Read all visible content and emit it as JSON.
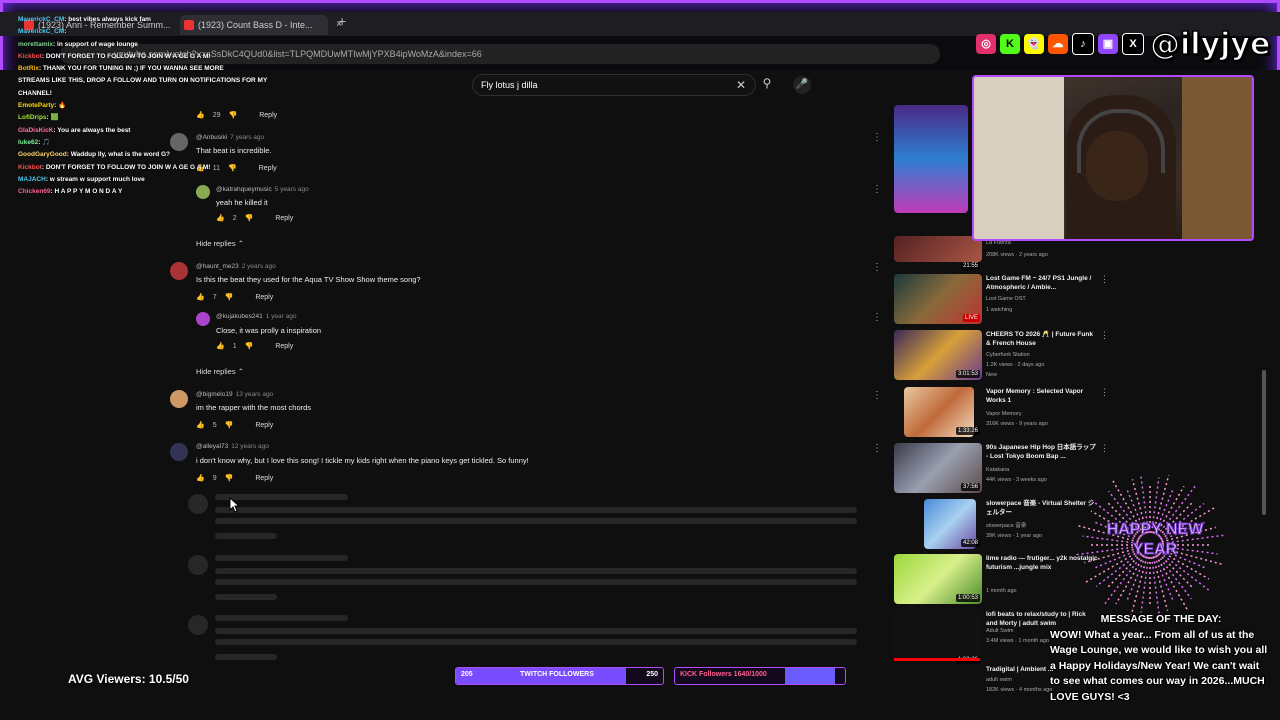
{
  "browser": {
    "tabs": [
      {
        "label": "(1923) Anri - Remember Summ..."
      },
      {
        "label": "(1923) Count Bass D - Inte..."
      }
    ],
    "url": "youtube.com/watch?v=sSsDkC4QUd0&list=TLPQMDUwMTIwMjYPXB4ipWoMzA&index=66"
  },
  "search": {
    "query": "Fly lotus j dilla"
  },
  "comments": [
    {
      "author": "",
      "age": "",
      "text": "",
      "likes": "29",
      "reply": "Reply",
      "partial": true
    },
    {
      "author": "@Anbusiki",
      "age": "7 years ago",
      "text": "That beat is incredible.",
      "likes": "11",
      "reply": "Reply"
    },
    {
      "author": "@katrahqueymusic",
      "age": "5 years ago",
      "text": "yeah he killed it",
      "likes": "2",
      "reply": "Reply",
      "nested": true
    },
    {
      "author": "@haunt_me23",
      "age": "2 years ago",
      "text": "Is this the beat they used for the Aqua TV Show Show theme song?",
      "likes": "7",
      "reply": "Reply"
    },
    {
      "author": "@kujakubes241",
      "age": "1 year ago",
      "text": "Close, it was prolly a inspiration",
      "likes": "1",
      "reply": "Reply",
      "nested": true
    },
    {
      "author": "@bigmelo19",
      "age": "13 years ago",
      "text": "im the rapper with the most chords",
      "likes": "5",
      "reply": "Reply"
    },
    {
      "author": "@alleyal73",
      "age": "12 years ago",
      "text": "i don't know why, but I love this song! I tickle my kids right when the piano keys get tickled.  So funny!",
      "likes": "9",
      "reply": "Reply"
    }
  ],
  "hide_replies": "Hide replies",
  "sidebar": [
    {
      "title": "",
      "meta": [
        "La Fuerza",
        "208K views · 2 years ago"
      ],
      "duration": "21:55"
    },
    {
      "title": "Lost Game FM ~ 24/7 PS1 Jungle / Atmospheric / Ambie...",
      "meta": [
        "Lost Game OST",
        "1 watching"
      ],
      "duration": "LIVE"
    },
    {
      "title": "CHEERS TO 2026 🥂 | Future Funk & French House",
      "meta": [
        "Cyberfunk Station",
        "1.2K views · 2 days ago",
        "New"
      ],
      "duration": "3:01:53"
    },
    {
      "title": "Vapor Memory : Selected Vapor Works 1",
      "meta": [
        "Vapor Memory",
        "316K views · 9 years ago"
      ],
      "duration": "1:33:26"
    },
    {
      "title": "90s Japanese Hip Hop 日本語ラップ - Lost Tokyo Boom Bap ...",
      "meta": [
        "Katakana",
        "44K views · 3 weeks ago"
      ],
      "duration": "37:56"
    },
    {
      "title": "slowerpace 音楽 - Virtual Shelter シェルター",
      "meta": [
        "slowerpace 音楽",
        "39K views · 1 year ago"
      ],
      "duration": "42:08"
    },
    {
      "title": "lime radio — frutiger... y2k nostalgic futurism ...jungle mix",
      "meta": [
        "",
        "1 month ago"
      ],
      "duration": "1:00:53"
    },
    {
      "title": "lofi beats to relax/study to | Rick and Morty | adult swim",
      "meta": [
        "Adult Swim",
        "3.4M views · 1 month ago"
      ],
      "duration": "1:02:26"
    },
    {
      "title": "Tradigital | Ambient ...",
      "meta": [
        "adult swim",
        "182K views · 4 months ago"
      ],
      "duration": ""
    }
  ],
  "stream": {
    "handle": "@ilyjye",
    "avg_viewers": "AVG Viewers: 10.5/50",
    "twitch": {
      "current": "205",
      "label": "TWITCH FOLLOWERS",
      "goal": "250",
      "progress": 0.82
    },
    "kick": {
      "label": "KICK Followers 1640/1000",
      "progress": 1.0
    },
    "motd_head": "MESSAGE OF THE DAY:",
    "motd_body": "WOW! What a year... From all of us at the Wage Lounge, we would like to wish you all a Happy Holidays/New Year! We can't wait to see what comes our way in 2026...MUCH LOVE GUYS! <3",
    "firework_text": "HAPPY NEW YEAR",
    "socials": [
      "instagram-icon",
      "kick-icon",
      "snapchat-icon",
      "soundcloud-icon",
      "tiktok-icon",
      "twitch-icon",
      "x-icon"
    ]
  },
  "chat": [
    {
      "name": "MaverickC_CM",
      "msg": ": best vibes always kick fam",
      "color": "#4cc9f0"
    },
    {
      "name": "MaverickC_CM",
      "msg": ": ",
      "color": "#4cc9f0"
    },
    {
      "name": "morettamix",
      "msg": ": in support of wage lounge",
      "color": "#7bd389"
    },
    {
      "name": "Kickbot",
      "msg": ": DON'T FORGET TO FOLLOW TO JOIN W A GE G A M!",
      "color": "#ff4d4d"
    },
    {
      "name": "BotRix",
      "msg": ": THANK YOU FOR TUNING IN ;) IF YOU WANNA SEE MORE",
      "color": "#ffb703"
    },
    {
      "name": "",
      "msg": "STREAMS LIKE THIS, DROP A FOLLOW AND TURN ON NOTIFICATIONS FOR MY",
      "color": "#ffffff"
    },
    {
      "name": "",
      "msg": "CHANNEL!",
      "color": "#ffffff"
    },
    {
      "name": "EmoteParty",
      "msg": ": 🔥",
      "color": "#ffd60a"
    },
    {
      "name": "LofiDrips",
      "msg": ": 🟩",
      "color": "#a3e635"
    },
    {
      "name": "GlaDisKicK",
      "msg": ": You are always the best",
      "color": "#ff70a6"
    },
    {
      "name": "luke62",
      "msg": ": 🎵",
      "color": "#80ed99"
    },
    {
      "name": "GoodGaryGood",
      "msg": ": Waddup Ily, what is the word G?",
      "color": "#ffd166"
    },
    {
      "name": "Kickbot",
      "msg": ": DON'T FORGET TO FOLLOW TO JOIN W A GE G A M!",
      "color": "#ff4d4d"
    },
    {
      "name": "MAJACH",
      "msg": ": w stream w support much love",
      "color": "#4cc9f0"
    },
    {
      "name": "Chicken69",
      "msg": ": H A P P Y  M O N D A Y",
      "color": "#ff5d8f"
    }
  ],
  "colors": {
    "accent": "#b04bff",
    "yt_bg": "#0f0f0f",
    "red": "#ff0000"
  }
}
